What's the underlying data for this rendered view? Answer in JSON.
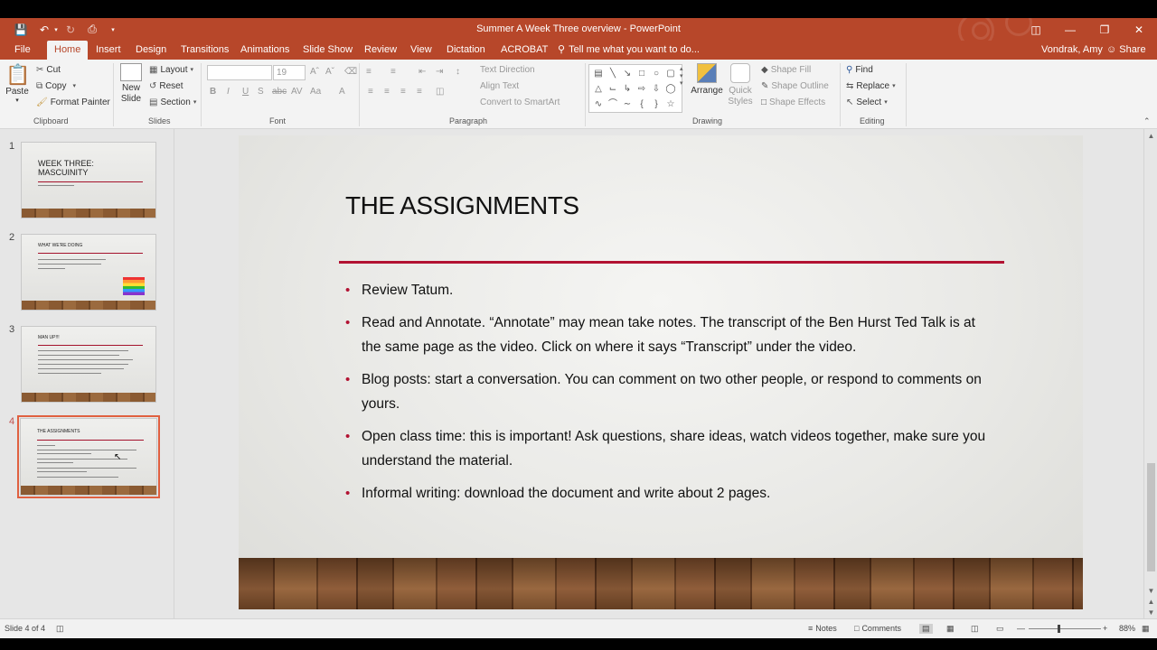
{
  "window": {
    "title": "Summer A Week Three overview - PowerPoint",
    "user": "Vondrak, Amy",
    "share_label": "Share"
  },
  "tabs": [
    "File",
    "Home",
    "Insert",
    "Design",
    "Transitions",
    "Animations",
    "Slide Show",
    "Review",
    "View",
    "Dictation",
    "ACROBAT"
  ],
  "tell_me": "Tell me what you want to do...",
  "ribbon": {
    "clipboard": {
      "paste": "Paste",
      "cut": "Cut",
      "copy": "Copy",
      "format_painter": "Format Painter",
      "label": "Clipboard"
    },
    "slides": {
      "new_slide": "New Slide",
      "layout": "Layout",
      "reset": "Reset",
      "section": "Section",
      "label": "Slides"
    },
    "font": {
      "font_size": "19",
      "label": "Font"
    },
    "paragraph": {
      "text_direction": "Text Direction",
      "align_text": "Align Text",
      "convert_smartart": "Convert to SmartArt",
      "label": "Paragraph"
    },
    "drawing": {
      "arrange": "Arrange",
      "quick_styles": "Quick Styles",
      "shape_fill": "Shape Fill",
      "shape_outline": "Shape Outline",
      "shape_effects": "Shape Effects",
      "label": "Drawing"
    },
    "editing": {
      "find": "Find",
      "replace": "Replace",
      "select": "Select",
      "label": "Editing"
    }
  },
  "thumbnails": [
    {
      "num": "1",
      "title": "WEEK THREE:\nMASCUINITY"
    },
    {
      "num": "2",
      "title": "WHAT WE'RE DOING"
    },
    {
      "num": "3",
      "title": "MAN UP!!!"
    },
    {
      "num": "4",
      "title": "THE ASSIGNMENTS"
    }
  ],
  "slide": {
    "title": "THE ASSIGNMENTS",
    "bullets": [
      "Review Tatum.",
      "Read and Annotate. “Annotate” may mean take notes. The transcript of the Ben Hurst Ted Talk is at the same page as the video. Click on where it says “Transcript” under the video.",
      "Blog posts: start a conversation. You can comment on two other people, or respond to comments on yours.",
      "Open class time: this is important! Ask questions, share ideas, watch videos together, make sure you understand the material.",
      "Informal writing: download the document and write about 2 pages."
    ]
  },
  "status": {
    "slide_info": "Slide 4 of 4",
    "notes": "Notes",
    "comments": "Comments",
    "zoom": "88%"
  },
  "colors": {
    "accent": "#b7472a",
    "rule": "#b21232"
  }
}
